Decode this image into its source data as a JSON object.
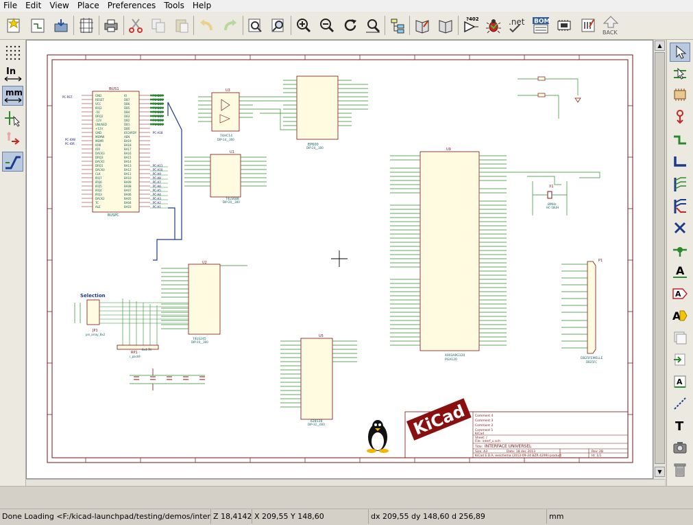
{
  "menu": [
    "File",
    "Edit",
    "View",
    "Place",
    "Preferences",
    "Tools",
    "Help"
  ],
  "top_toolbar": {
    "icons": [
      "new-schematic-icon",
      "open-project-icon",
      "save-icon",
      "page-settings-icon",
      "print-icon",
      "cut-icon",
      "copy-icon",
      "paste-icon",
      "undo-icon",
      "redo-icon",
      "find-icon",
      "find-replace-icon",
      "zoom-in-icon",
      "zoom-out-icon",
      "redraw-icon",
      "zoom-fit-icon",
      "hierarchy-navigator-icon",
      "library-editor-icon",
      "library-browser-icon",
      "annotate-icon",
      "erc-icon",
      "netlist-icon",
      "bom-icon",
      "cvpcb-icon",
      "pcbnew-icon",
      "back-icon"
    ],
    "annotate_label": "?402",
    "netlist_label": ".net",
    "bom_label": "BOM",
    "back_label": "BACK"
  },
  "left_toolbar": {
    "grid_tip": "Show grid",
    "units_in": "In",
    "units_mm": "mm"
  },
  "right_toolbar": {
    "label_a": "A",
    "text_t": "T"
  },
  "schematic": {
    "title_block": {
      "comments": [
        "Comment 4",
        "Comment 3",
        "Comment 2",
        "Comment 1",
        "KiCad"
      ],
      "sheet": "Sheet: /",
      "file": "File: interf_u.sch",
      "title_label": "Title:",
      "title": "INTERFACE UNIVERSEL",
      "size": "Size: A3",
      "date": "Date: 18 dec 2013",
      "rev": "Rev: 2B",
      "kicad": "KiCad E.D.A.  eeschema (2013-09-24 BZR 4299)-product",
      "id": "Id: 1/1",
      "logo": "KiCad"
    },
    "components": {
      "bus1": "BUS1",
      "busbpc": "BUSPC",
      "u3": "U3",
      "u3_val": "74HC14",
      "u3_fp": "DIP-14__300",
      "u6": "U6",
      "u6_val": "EP600",
      "u6_fp": "DIP-24__300",
      "u1": "U1",
      "u1_val": "74LS688",
      "u1_fp": "DIP-20__300",
      "u2": "U2",
      "u2_val": "74LS245",
      "u2_fp": "DIP-20__300",
      "u9": "U9",
      "u9_val": "4003APG120",
      "u9_fp": "PGA120",
      "u5": "U5",
      "u5_val": "628128",
      "u5_fp": "DIP-32__600",
      "jp1": "JP1",
      "jp1_fp": "pin_array_8x2",
      "rp1": "RP1",
      "rp1_val": "8x4.7K",
      "rp1_fp": "r_pack9",
      "p1": "P1",
      "p1_val": "DB25FEMELLE",
      "p1_fp": "DB25FC",
      "x1": "X1",
      "x1_val": "8MHz",
      "x1_fp": "HC-18UH",
      "selection": "Selection"
    }
  },
  "status": {
    "message": "Done Loading <F:/kicad-launchpad/testing/demos/interf_u/i...",
    "zoom": "Z 18,4142",
    "xy": "X 209,55  Y 148,60",
    "delta": "dx 209,55  dy 148,60  d 256,89",
    "units": "mm"
  }
}
